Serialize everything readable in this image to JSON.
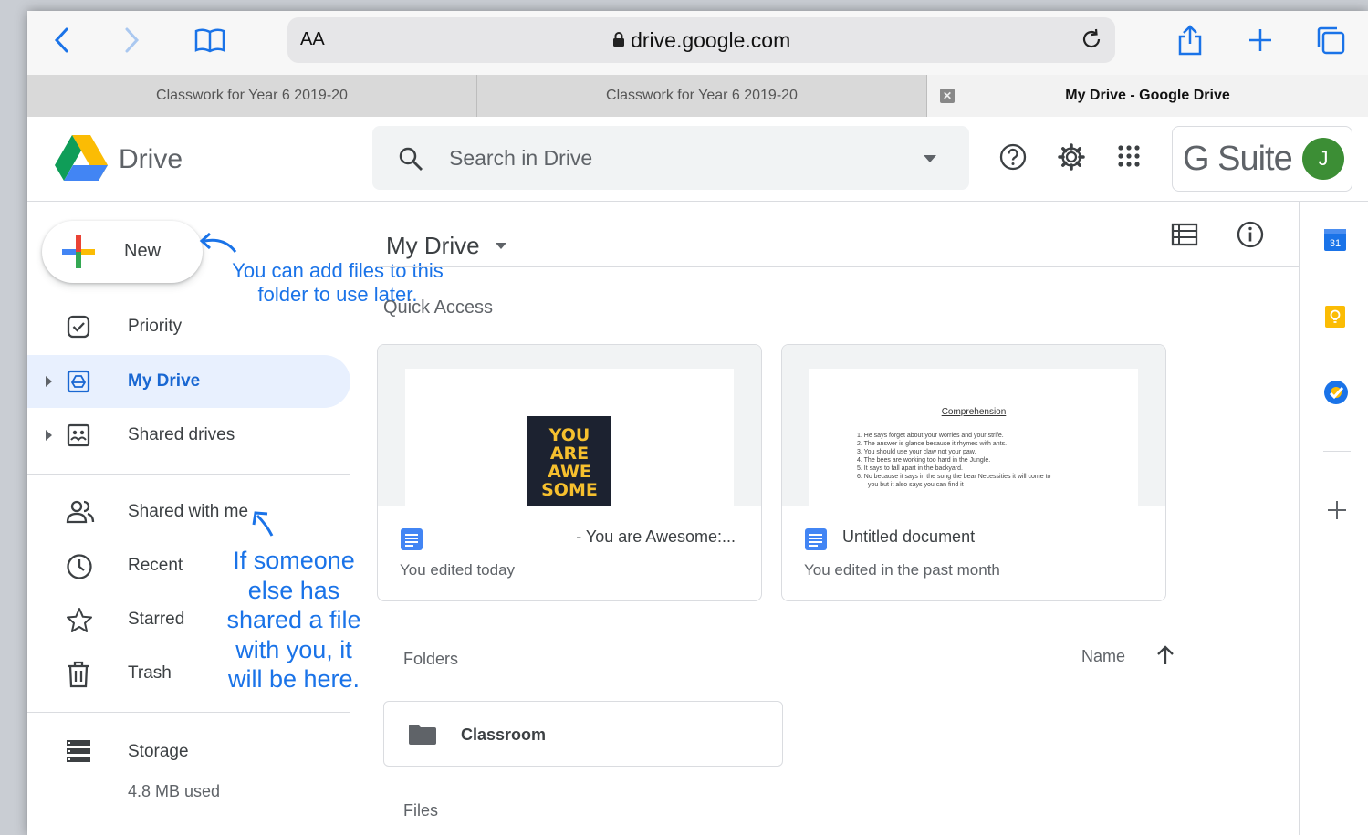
{
  "browser": {
    "text_size_label": "AA",
    "url": "drive.google.com",
    "tabs": [
      {
        "title": "Classwork for Year 6 2019-20"
      },
      {
        "title": "Classwork for Year 6 2019-20"
      },
      {
        "title": "My Drive - Google Drive",
        "active": true
      }
    ]
  },
  "header": {
    "app_name": "Drive",
    "search_placeholder": "Search in Drive",
    "gsuite_label": "G Suite",
    "avatar_initial": "J"
  },
  "sidebar": {
    "new_label": "New",
    "items": [
      {
        "label": "Priority",
        "icon": "priority-icon"
      },
      {
        "label": "My Drive",
        "icon": "my-drive-icon",
        "active": true
      },
      {
        "label": "Shared drives",
        "icon": "shared-drives-icon"
      },
      {
        "label": "Shared with me",
        "icon": "shared-with-me-icon"
      },
      {
        "label": "Recent",
        "icon": "clock-icon"
      },
      {
        "label": "Starred",
        "icon": "star-icon"
      },
      {
        "label": "Trash",
        "icon": "trash-icon"
      },
      {
        "label": "Storage",
        "icon": "storage-icon"
      }
    ],
    "storage_used": "4.8 MB used"
  },
  "annotations": {
    "new_note": "You can add files to this folder to use later.",
    "shared_note": "If someone else has shared a file with you, it will be here."
  },
  "main": {
    "title": "My Drive",
    "quick_access_label": "Quick Access",
    "cards": [
      {
        "name": "- You are Awesome:...",
        "sub": "You edited today",
        "book_title": [
          "YOU",
          "ARE",
          "AWE",
          "SOME"
        ]
      },
      {
        "name": "Untitled document",
        "sub": "You edited in the past month",
        "doc_title": "Comprehension",
        "doc_lines": [
          "1. He says forget about your worries and your strife.",
          "2. The answer is glance because it rhymes with ants.",
          "3. You should use your claw not your paw.",
          "4. The bees are working too hard in the Jungle.",
          "5. It says to fall apart in the backyard.",
          "6. No because it says in the song the bear Necessities it will come to",
          "you but it also says you can find it"
        ]
      }
    ],
    "folders_label": "Folders",
    "sort_label": "Name",
    "folders": [
      {
        "name": "Classroom"
      }
    ],
    "files_label": "Files"
  },
  "colors": {
    "accent": "#1a73e8",
    "active_nav_bg": "#e8f0fe",
    "avatar": "#3c8e35"
  }
}
